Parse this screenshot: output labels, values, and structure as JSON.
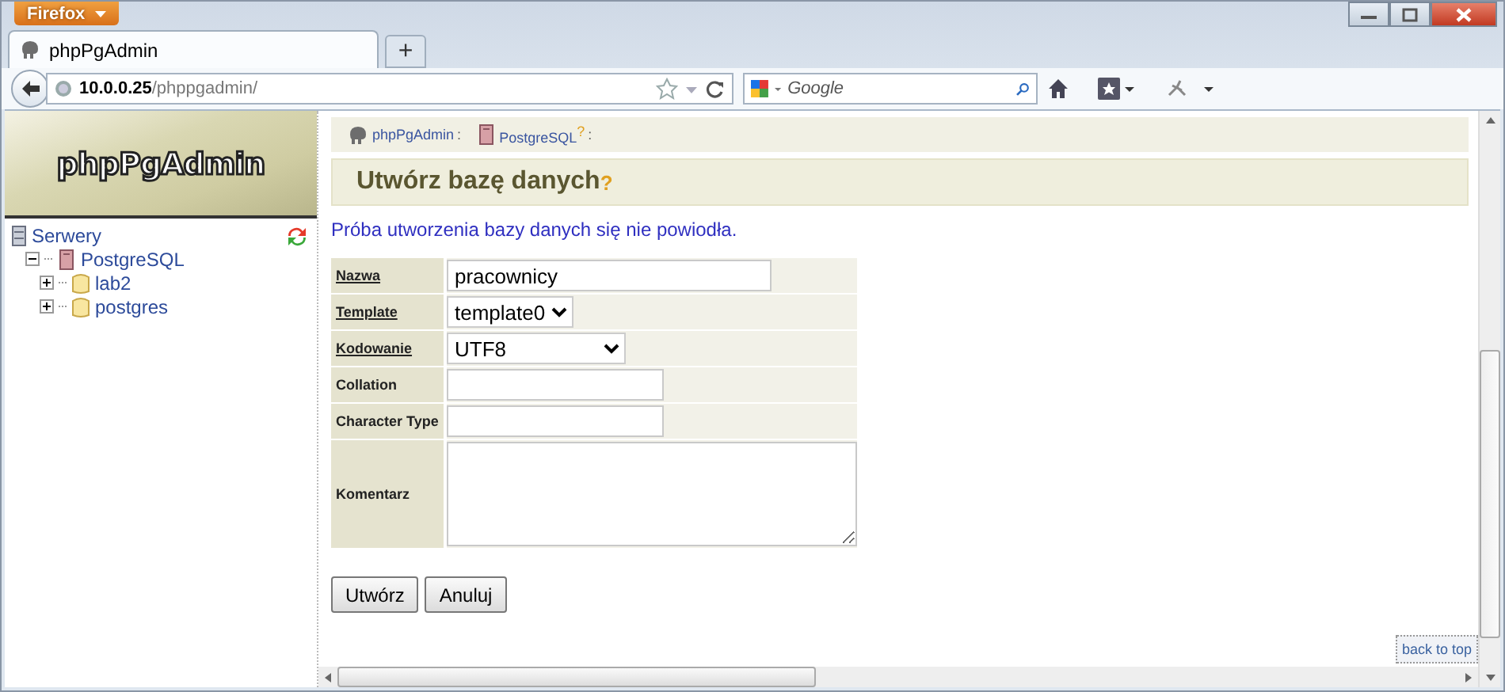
{
  "browser": {
    "menu_button": "Firefox",
    "tabs": [
      {
        "label": "phpPgAdmin",
        "selected": true
      }
    ],
    "new_tab": "+",
    "address": {
      "host": "10.0.0.25",
      "path": "/phppgadmin/"
    },
    "search": {
      "placeholder": "Google"
    }
  },
  "sidebar": {
    "logo": "phpPgAdmin",
    "tree": [
      {
        "label": "Serwery",
        "kind": "servers",
        "children": [
          {
            "label": "PostgreSQL",
            "kind": "server",
            "expanded": true,
            "children": [
              {
                "label": "lab2",
                "kind": "database",
                "expanded": false
              },
              {
                "label": "postgres",
                "kind": "database",
                "expanded": false
              }
            ]
          }
        ]
      }
    ]
  },
  "breadcrumb": [
    {
      "label": "phpPgAdmin",
      "kind": "app",
      "separator": ":"
    },
    {
      "label": "PostgreSQL",
      "kind": "server",
      "help": "?",
      "separator": ":"
    }
  ],
  "heading": {
    "text": "Utwórz bazę danych",
    "help": "?"
  },
  "message": "Próba utworzenia bazy danych się nie powiodła.",
  "fields": [
    {
      "label": "Nazwa",
      "link": true,
      "kind": "text",
      "value": "pracownicy"
    },
    {
      "label": "Template",
      "link": true,
      "kind": "select",
      "value": "template0"
    },
    {
      "label": "Kodowanie",
      "link": true,
      "kind": "select",
      "value": "UTF8"
    },
    {
      "label": "Collation",
      "link": false,
      "kind": "text"
    },
    {
      "label": "Character Type",
      "link": false,
      "kind": "text"
    },
    {
      "label": "Komentarz",
      "link": false,
      "kind": "textarea"
    }
  ],
  "buttons": [
    "Utwórz",
    "Anuluj"
  ],
  "back_to_top": "back to top"
}
